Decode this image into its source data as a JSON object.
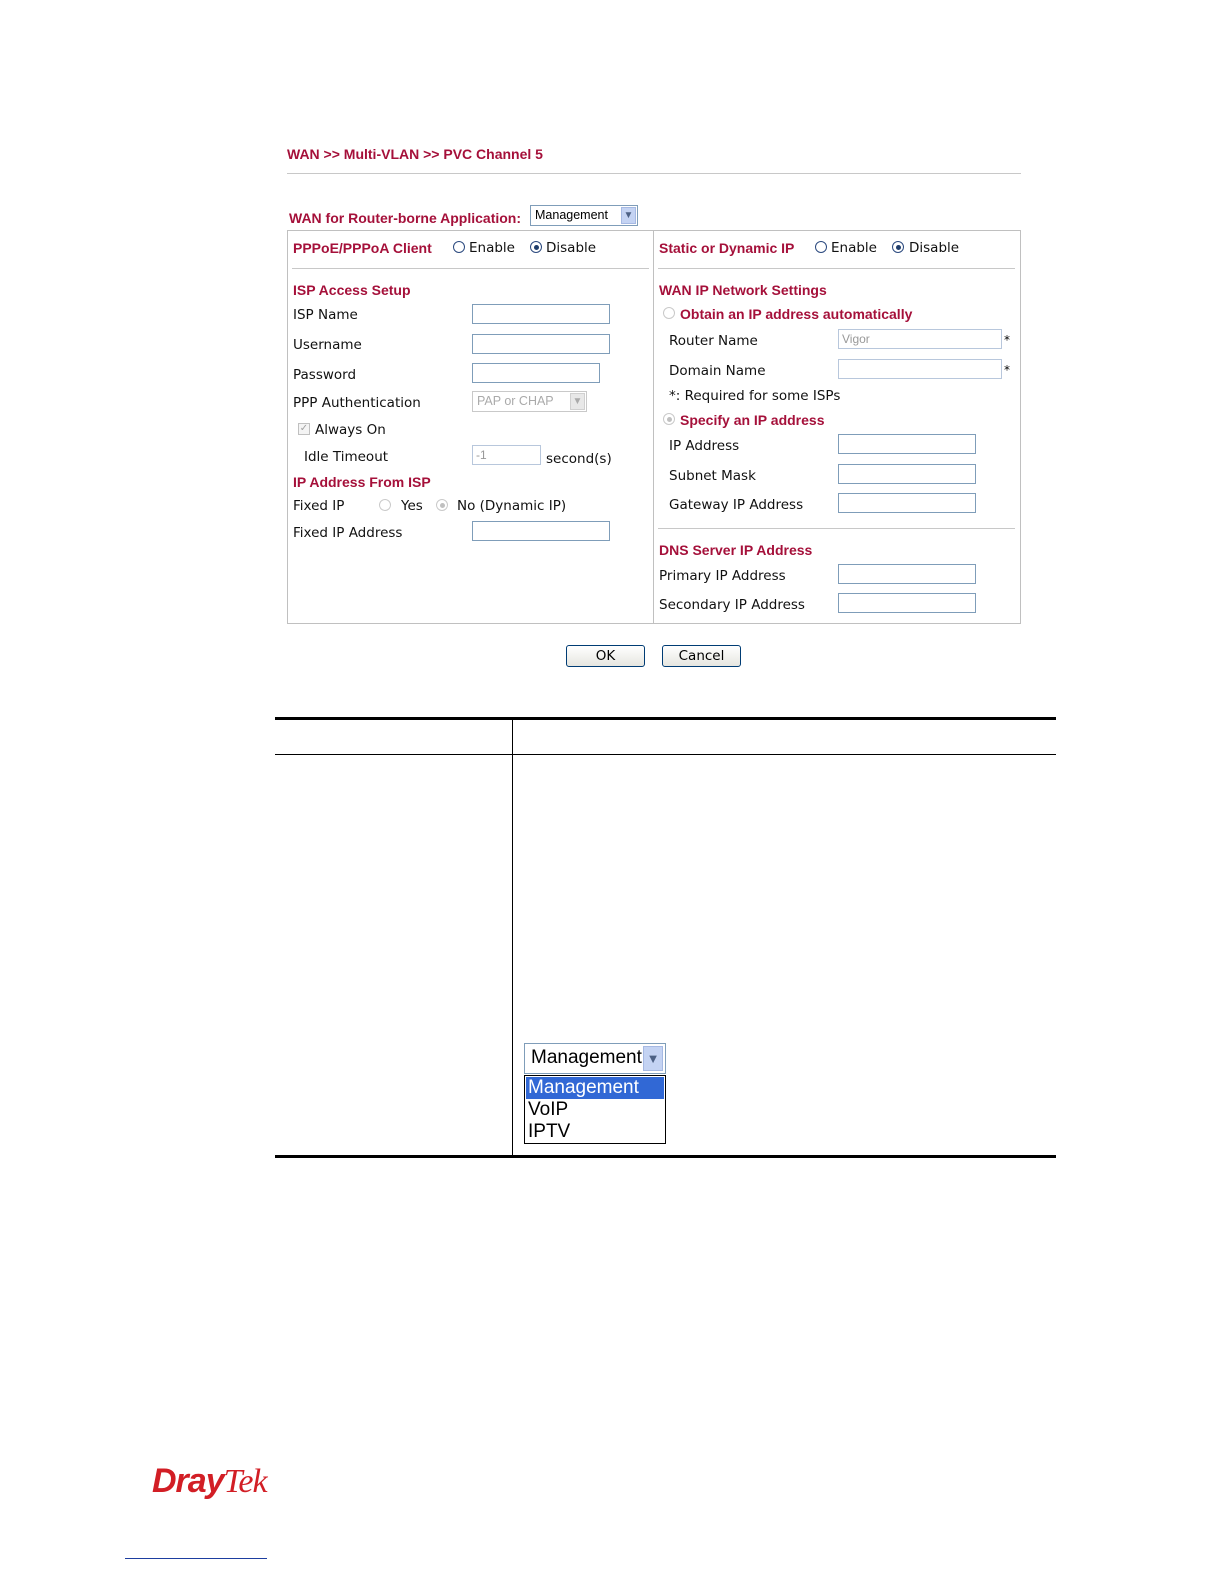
{
  "breadcrumb": "WAN >> Multi-VLAN >> PVC Channel 5",
  "router_app": {
    "label": "WAN for Router-borne Application:",
    "selected": "Management"
  },
  "left": {
    "pppoe_title": "PPPoE/PPPoA Client",
    "enable": "Enable",
    "disable": "Disable",
    "pppoe_state": "Disable",
    "isp_access_title": "ISP Access Setup",
    "isp_name": "ISP Name",
    "username": "Username",
    "password": "Password",
    "ppp_auth": "PPP Authentication",
    "ppp_auth_value": "PAP or CHAP",
    "always_on": "Always On",
    "always_on_checked": true,
    "idle_timeout": "Idle Timeout",
    "idle_timeout_value": "-1",
    "seconds": "second(s)",
    "ip_from_isp_title": "IP Address From ISP",
    "fixed_ip": "Fixed IP",
    "yes": "Yes",
    "no_dynamic": "No (Dynamic IP)",
    "fixed_ip_address": "Fixed IP Address"
  },
  "right": {
    "static_dynamic_title": "Static or Dynamic IP",
    "enable": "Enable",
    "disable": "Disable",
    "static_state": "Disable",
    "wan_ip_title": "WAN IP Network Settings",
    "obtain_auto": "Obtain an IP address automatically",
    "router_name": "Router Name",
    "router_name_value": "Vigor",
    "domain_name": "Domain Name",
    "required_note": "*: Required for some ISPs",
    "specify_ip": "Specify an IP address",
    "ip_address": "IP Address",
    "subnet_mask": "Subnet Mask",
    "gateway_ip": "Gateway IP Address",
    "dns_title": "DNS Server IP Address",
    "primary_ip": "Primary IP Address",
    "secondary_ip": "Secondary IP Address",
    "star": "*"
  },
  "buttons": {
    "ok": "OK",
    "cancel": "Cancel"
  },
  "dropdown_example": {
    "selected": "Management",
    "options": [
      "Management",
      "VoIP",
      "IPTV"
    ]
  },
  "logo": {
    "dray": "Dray",
    "tek": "Tek"
  }
}
